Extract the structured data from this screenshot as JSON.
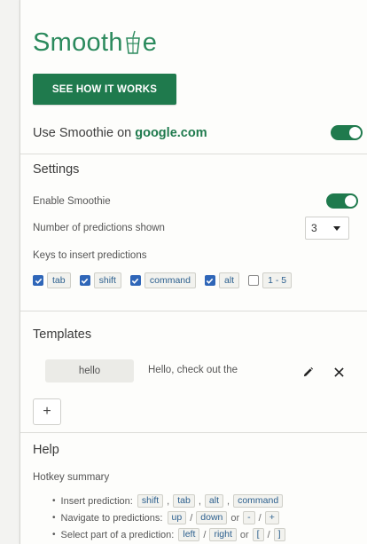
{
  "brand": {
    "name_before": "Smooth",
    "name_after": "e"
  },
  "header": {
    "how_button": "SEE HOW IT WORKS"
  },
  "use_on": {
    "label": "Use Smoothie on",
    "domain": "google.com",
    "enabled": true
  },
  "settings": {
    "title": "Settings",
    "enable_label": "Enable Smoothie",
    "enable_on": true,
    "predictions_label": "Number of predictions shown",
    "predictions_value": "3",
    "keys_label": "Keys to insert predictions",
    "keys": [
      {
        "label": "tab",
        "checked": true
      },
      {
        "label": "shift",
        "checked": true
      },
      {
        "label": "command",
        "checked": true
      },
      {
        "label": "alt",
        "checked": true
      },
      {
        "label": "1 - 5",
        "checked": false
      }
    ]
  },
  "templates": {
    "title": "Templates",
    "items": [
      {
        "key": "hello",
        "value": "Hello, check out the"
      }
    ],
    "add_label": "+"
  },
  "help": {
    "title": "Help",
    "hotkey_title": "Hotkey summary",
    "insert_label": "Insert prediction:",
    "insert_keys": [
      "shift",
      "tab",
      "alt",
      "command"
    ],
    "navigate_label": "Navigate to predictions:",
    "navigate_keys": [
      "up",
      "down",
      "-",
      "+"
    ],
    "navigate_seps": [
      "/",
      "or",
      "/"
    ],
    "select_label": "Select part of a prediction:",
    "select_keys": [
      "left",
      "right",
      "[",
      "]"
    ],
    "select_seps": [
      "/",
      "or",
      "/"
    ],
    "comma": ","
  }
}
